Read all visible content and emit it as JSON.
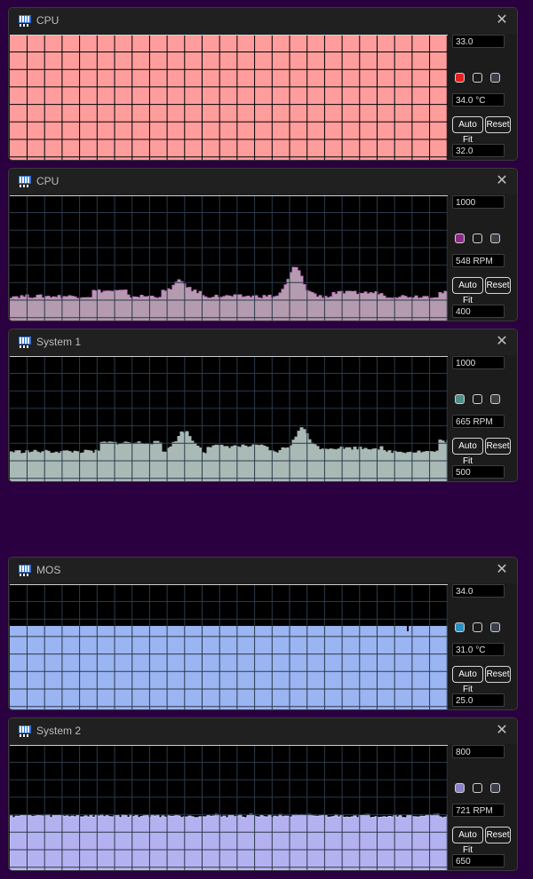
{
  "panels": [
    {
      "title": "CPU",
      "max": "33.0",
      "current": "34.0 °C",
      "min": "32.0",
      "swatch": "#e32020",
      "fill": "#ff9d9d",
      "grid": "#000000",
      "mode": "full",
      "level": 1.0
    },
    {
      "title": "CPU",
      "max": "1000",
      "current": "548 RPM",
      "min": "400",
      "swatch": "#8c2a88",
      "fill": "#b59bb0",
      "grid": "#2b3a4a",
      "mode": "series",
      "stroke": "#c27ac0"
    },
    {
      "title": "System 1",
      "max": "1000",
      "current": "665 RPM",
      "min": "500",
      "swatch": "#4e8c84",
      "fill": "#a9bab6",
      "grid": "#2b3a4a",
      "mode": "series",
      "stroke": "#a9bab6"
    },
    {
      "title": "MOS",
      "max": "34.0",
      "current": "31.0 °C",
      "min": "25.0",
      "swatch": "#2b8fc0",
      "fill": "#9bb4f2",
      "grid": "#2b3a4a",
      "mode": "flat",
      "level": 0.667
    },
    {
      "title": "System 2",
      "max": "800",
      "current": "721 RPM",
      "min": "650",
      "swatch": "#8a82c8",
      "fill": "#b4b1f0",
      "grid": "#2b3a4a",
      "mode": "series",
      "stroke": "#c8c6ff"
    }
  ],
  "buttons": {
    "autofit": "Auto Fit",
    "reset": "Reset"
  },
  "close_glyph": "✕",
  "colors": {
    "background": "#2a0040",
    "panel": "#1c1c1c"
  },
  "icon_names": {
    "app": "fan-icon",
    "close": "close-icon"
  }
}
